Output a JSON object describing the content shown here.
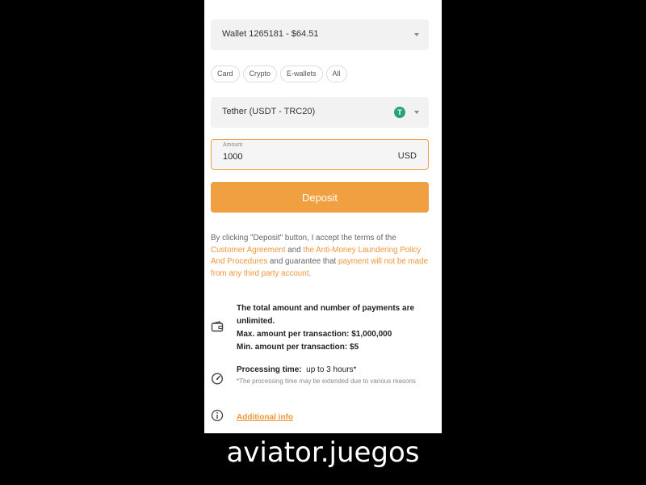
{
  "wallet": {
    "label": "Wallet 1265181 - $64.51"
  },
  "filters": [
    "Card",
    "Crypto",
    "E-wallets",
    "All"
  ],
  "method": {
    "label": "Tether (USDT - TRC20)",
    "icon": "tether-icon",
    "icon_glyph": "T",
    "icon_color": "#26a17b"
  },
  "amount": {
    "label": "Amount",
    "value": "1000",
    "currency": "USD"
  },
  "deposit": {
    "label": "Deposit",
    "color": "#f0a040"
  },
  "terms": {
    "t1": "By clicking \"Deposit\" button, I accept the terms of the ",
    "link1": "Customer Agreement",
    "t2": " and ",
    "link2": "the Anti-Money Laundering Policy And Procedures",
    "t3": " and guarantee that ",
    "link3": "payment will not be made from any third party account",
    "t4": "."
  },
  "limits": {
    "line1": "The total amount and number of payments are unlimited.",
    "max": "Max. amount per transaction: $1,000,000",
    "min": "Min. amount per transaction: $5"
  },
  "processing": {
    "label": "Processing time:",
    "value": "up to 3 hours*",
    "note": "*The processing time may be extended due to various reasons"
  },
  "additional": {
    "label": "Additional info"
  },
  "footer": {
    "text": "aviator.juegos"
  }
}
